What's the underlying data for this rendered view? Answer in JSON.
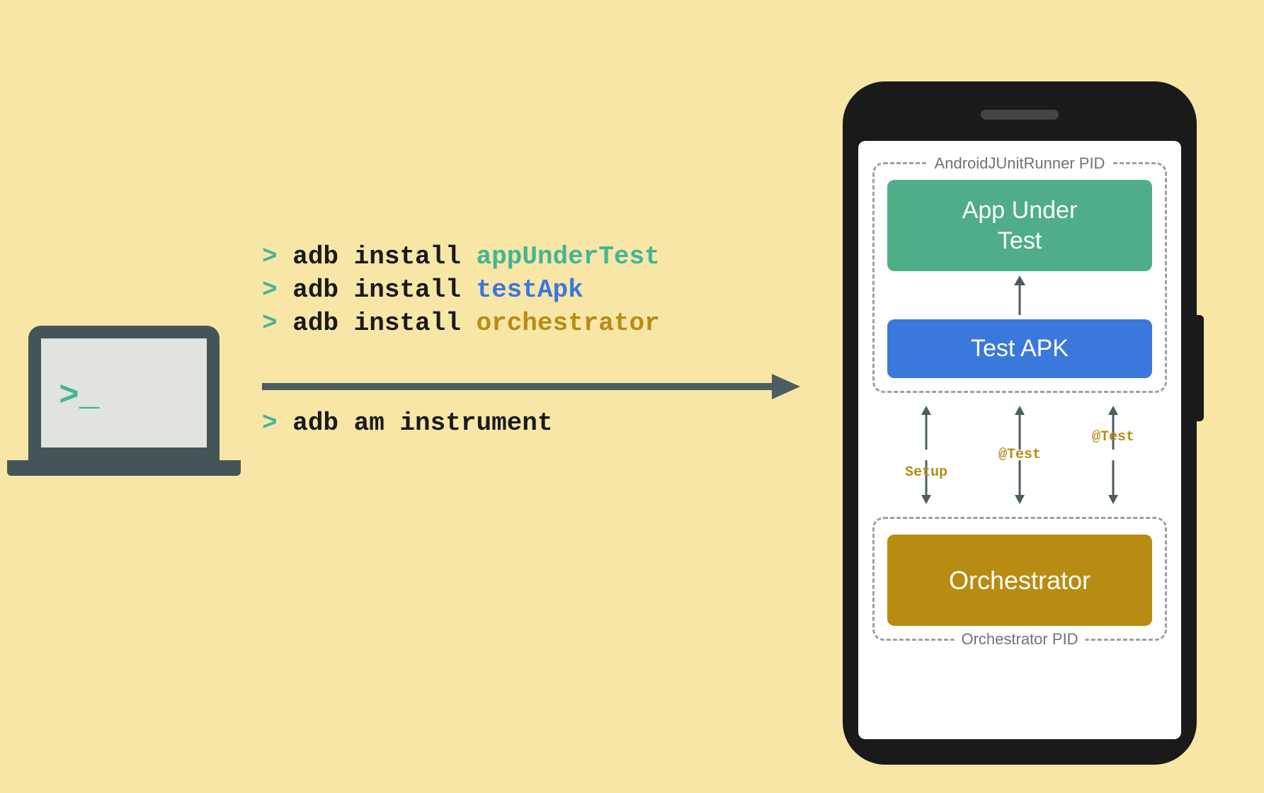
{
  "terminal_prompt_glyph": ">_",
  "commands_above": [
    {
      "prefix": "> ",
      "cmd": "adb install ",
      "arg": "appUnderTest",
      "arg_color": "green"
    },
    {
      "prefix": "> ",
      "cmd": "adb install ",
      "arg": "testApk",
      "arg_color": "blue"
    },
    {
      "prefix": "> ",
      "cmd": "adb install ",
      "arg": "orchestrator",
      "arg_color": "yellow"
    }
  ],
  "commands_below": [
    {
      "prefix": "> ",
      "cmd": "adb am instrument",
      "arg": "",
      "arg_color": ""
    }
  ],
  "phone": {
    "groups": {
      "top_label": "AndroidJUnitRunner PID",
      "bottom_label": "Orchestrator PID"
    },
    "blocks": {
      "app_under_test": "App Under\nTest",
      "test_apk": "Test APK",
      "orchestrator": "Orchestrator"
    },
    "bi_arrows": [
      "Setup",
      "@Test",
      "@Test"
    ]
  },
  "colors": {
    "green": "#4fae87",
    "blue": "#3b78dc",
    "yellow": "#b88c13",
    "dark": "#44555a",
    "bg": "#f7e6a6"
  }
}
